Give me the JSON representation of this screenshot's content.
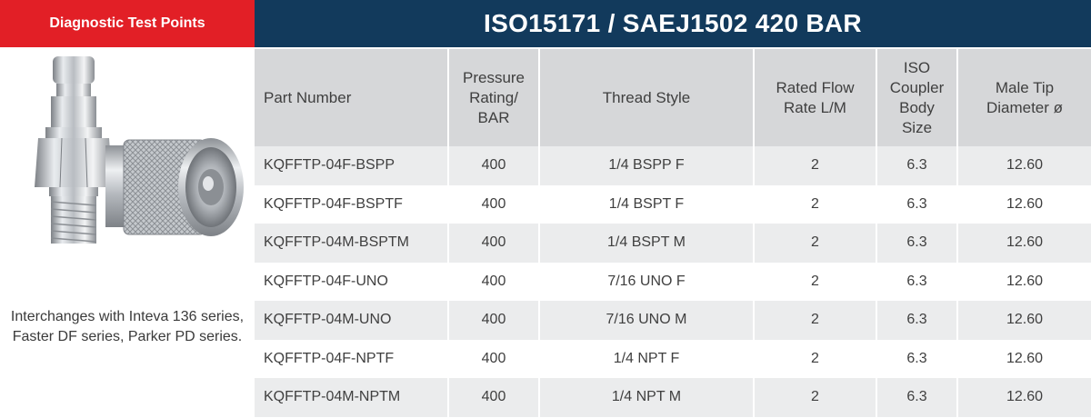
{
  "badge": {
    "label": "Diagnostic Test Points"
  },
  "title": "ISO15171 / SAEJ1502 420 BAR",
  "caption": "Interchanges with Inteva 136 series, Faster DF series, Parker PD series.",
  "table": {
    "headers": {
      "part_number": "Part Number",
      "pressure_rating": "Pressure Rating/ BAR",
      "thread_style": "Thread Style",
      "rated_flow": "Rated Flow Rate L/M",
      "iso_coupler": "ISO Coupler Body Size",
      "male_tip": "Male Tip Diameter ø"
    },
    "rows": [
      {
        "part_number": "KQFFTP-04F-BSPP",
        "pressure_rating": "400",
        "thread_style": "1/4 BSPP F",
        "rated_flow": "2",
        "iso_coupler": "6.3",
        "male_tip": "12.60"
      },
      {
        "part_number": "KQFFTP-04F-BSPTF",
        "pressure_rating": "400",
        "thread_style": "1/4 BSPT F",
        "rated_flow": "2",
        "iso_coupler": "6.3",
        "male_tip": "12.60"
      },
      {
        "part_number": "KQFFTP-04M-BSPTM",
        "pressure_rating": "400",
        "thread_style": "1/4 BSPT M",
        "rated_flow": "2",
        "iso_coupler": "6.3",
        "male_tip": "12.60"
      },
      {
        "part_number": "KQFFTP-04F-UNO",
        "pressure_rating": "400",
        "thread_style": "7/16 UNO F",
        "rated_flow": "2",
        "iso_coupler": "6.3",
        "male_tip": "12.60"
      },
      {
        "part_number": "KQFFTP-04M-UNO",
        "pressure_rating": "400",
        "thread_style": "7/16 UNO M",
        "rated_flow": "2",
        "iso_coupler": "6.3",
        "male_tip": "12.60"
      },
      {
        "part_number": "KQFFTP-04F-NPTF",
        "pressure_rating": "400",
        "thread_style": "1/4 NPT F",
        "rated_flow": "2",
        "iso_coupler": "6.3",
        "male_tip": "12.60"
      },
      {
        "part_number": "KQFFTP-04M-NPTM",
        "pressure_rating": "400",
        "thread_style": "1/4 NPT M",
        "rated_flow": "2",
        "iso_coupler": "6.3",
        "male_tip": "12.60"
      }
    ]
  },
  "colors": {
    "badge_red": "#e21f26",
    "title_navy": "#123a5c",
    "header_gray": "#d6d7d9",
    "row_stripe": "#ebeced"
  },
  "icons": {
    "product_image": "hydraulic-test-coupling-icon"
  }
}
